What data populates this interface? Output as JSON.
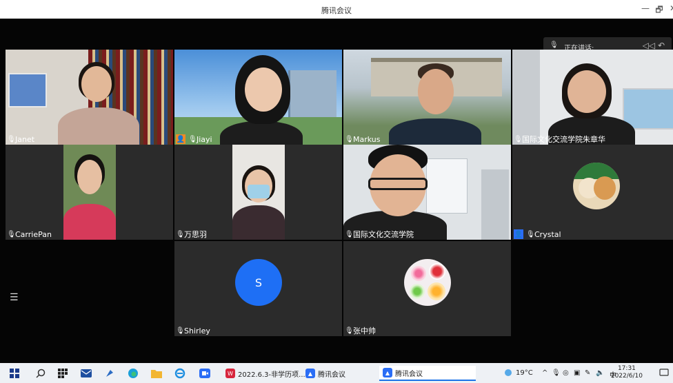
{
  "window": {
    "title": "腾讯会议",
    "min_glyph": "—",
    "restore_glyph": "🗗",
    "close_glyph": "✕"
  },
  "speaking": {
    "label": "正在讲话:",
    "mic_glyph": "🎙",
    "ctrl_glyph": "◁◁ ↶"
  },
  "participants": [
    {
      "name": "Janet"
    },
    {
      "name": "Jiayi"
    },
    {
      "name": "Markus"
    },
    {
      "name": "国际文化交流学院朱章华"
    },
    {
      "name": "CarriePan"
    },
    {
      "name": "万思羽"
    },
    {
      "name": "国际文化交流学院"
    },
    {
      "name": "Crystal"
    },
    {
      "name": "Shirley",
      "initial": "S"
    },
    {
      "name": "张中帅"
    }
  ],
  "glyphs": {
    "mic": "🎙",
    "host": "👤",
    "menu": "☰"
  },
  "taskbar": {
    "apps": [
      {
        "label": "2022.6.3-非学历项..."
      },
      {
        "label": "腾讯会议"
      },
      {
        "label": "腾讯会议"
      }
    ],
    "weather": "19°C",
    "ime": "中",
    "time": "17:31",
    "date": "2022/6/10"
  },
  "colors": {
    "shirley_avatar": "#1e6ff5",
    "meeting_brand": "#2a6df5",
    "accent": "#1a73e8"
  }
}
